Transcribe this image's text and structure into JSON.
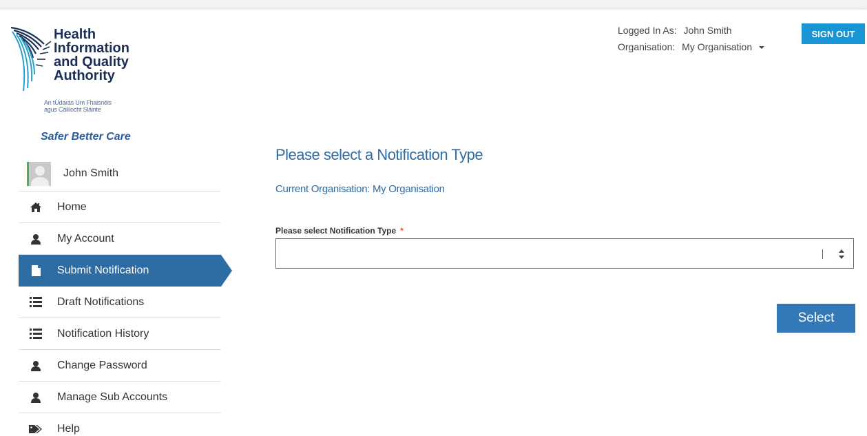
{
  "logo": {
    "name_lines": [
      "Health",
      "Information",
      "and Quality",
      "Authority"
    ],
    "irish_lines": [
      "An tÚdarás Um Fhaisnéis",
      "agus Cáilíocht Sláinte"
    ],
    "tagline": "Safer Better Care",
    "colors": {
      "primary": "#1b2f56",
      "accent": "#2a5a9a"
    }
  },
  "header": {
    "logged_in_label": "Logged In As:",
    "logged_in_user": "John Smith",
    "organisation_label": "Organisation:",
    "organisation_value": "My Organisation",
    "sign_out_label": "SIGN OUT",
    "sign_out_color": "#1a95d3"
  },
  "sidebar": {
    "user_name": "John Smith",
    "items": [
      {
        "label": "Home",
        "icon": "home-icon",
        "active": false
      },
      {
        "label": "My Account",
        "icon": "user-icon",
        "active": false
      },
      {
        "label": "Submit Notification",
        "icon": "document-icon",
        "active": true
      },
      {
        "label": "Draft Notifications",
        "icon": "list-icon",
        "active": false
      },
      {
        "label": "Notification History",
        "icon": "list-icon",
        "active": false
      },
      {
        "label": "Change Password",
        "icon": "user-icon",
        "active": false
      },
      {
        "label": "Manage Sub Accounts",
        "icon": "user-icon",
        "active": false
      },
      {
        "label": "Help",
        "icon": "tags-icon",
        "active": false
      }
    ],
    "active_color": "#2e6da4"
  },
  "main": {
    "title": "Please select a Notification Type",
    "current_org": "Current Organisation: My Organisation",
    "field_label": "Please select Notification Type",
    "required_marker": "*",
    "select_value": "",
    "select_button_label": "Select",
    "accent_color": "#2e6da4"
  }
}
